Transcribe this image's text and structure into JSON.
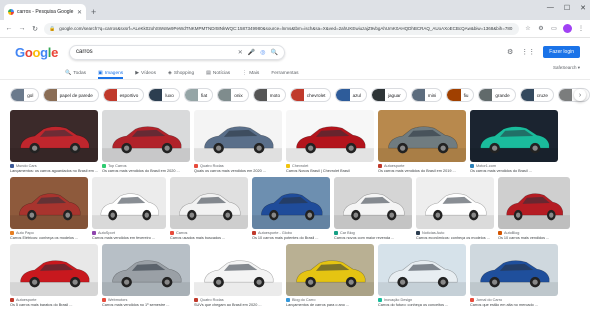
{
  "browser": {
    "tab_title": "carros - Pesquisa Google",
    "url": "google.com/search?q=carros&sxsrf=ALeKk02ohSWs8w9PeWdTNKMPMTNDrt8NkWQC:1587349980&source=lnms&tbm=isch&sa=X&ved=2ahUKEwiuzajZ9vbgAhUmK0AHQDhBCRAQ_AUoAXoECBcQAw&biw=1368&bih=780"
  },
  "search": {
    "query": "carros"
  },
  "header": {
    "signin_label": "Fazer login"
  },
  "tabs": [
    {
      "label": "Todas",
      "icon": "search-icon",
      "active": false
    },
    {
      "label": "Imagens",
      "icon": "image-icon",
      "active": true
    },
    {
      "label": "Vídeos",
      "icon": "video-icon",
      "active": false
    },
    {
      "label": "Shopping",
      "icon": "tag-icon",
      "active": false
    },
    {
      "label": "Notícias",
      "icon": "news-icon",
      "active": false
    },
    {
      "label": "Mais",
      "icon": "more-icon",
      "active": false
    },
    {
      "label": "Ferramentas",
      "icon": "",
      "active": false
    }
  ],
  "safesearch": "SafeSearch ▾",
  "chips": [
    {
      "label": "gol",
      "color": "#6b7a8c"
    },
    {
      "label": "papel de parede",
      "color": "#8a6d55"
    },
    {
      "label": "esportivo",
      "color": "#c0392b"
    },
    {
      "label": "luxo",
      "color": "#2c3e50"
    },
    {
      "label": "fiat",
      "color": "#95a5a6"
    },
    {
      "label": "onix",
      "color": "#7f8c8d"
    },
    {
      "label": "moto",
      "color": "#555555"
    },
    {
      "label": "chevrolet",
      "color": "#c0392b"
    },
    {
      "label": "azul",
      "color": "#2e5c9a"
    },
    {
      "label": "jaguar",
      "color": "#2d3436"
    },
    {
      "label": "mini",
      "color": "#5d6d7e"
    },
    {
      "label": "fiu",
      "color": "#a04000"
    },
    {
      "label": "grande",
      "color": "#616a6b"
    },
    {
      "label": "cruze",
      "color": "#34495e"
    },
    {
      "label": "hrev",
      "color": "#7b7d7d"
    }
  ],
  "results": [
    [
      {
        "source": "Mundo Cars",
        "caption": "Lançamentos: os carros aguardados no Brasil em ...",
        "bg": "#3b2a2a",
        "car": "#c0262d",
        "fav": "#3b5998"
      },
      {
        "source": "Top Carros",
        "caption": "Os carros mais vendidos do Brasil em 2020 ...",
        "bg": "#d9dadb",
        "car": "#b1222a",
        "fav": "#2ecc71"
      },
      {
        "source": "Quatro Rodas",
        "caption": "Quais os carros mais vendidos em 2020 ...",
        "bg": "#f4f4f4",
        "car": "#5a6f8a",
        "fav": "#e74c3c"
      },
      {
        "source": "Chevrolet",
        "caption": "Carros Novos Brasil | Chevrolet Brasil",
        "bg": "#f7f7f7",
        "car": "#b3141c",
        "fav": "#f1c40f"
      },
      {
        "source": "Autoesporte",
        "caption": "Os carros mais vendidos do Brasil em 2019 ...",
        "bg": "#b8894d",
        "car": "#707c80",
        "fav": "#c0392b"
      },
      {
        "source": "Motor1.com",
        "caption": "Os carros mais vendidos do Brasil ...",
        "bg": "#1b2430",
        "car": "#1abc9c",
        "fav": "#2980b9"
      }
    ],
    [
      {
        "source": "Auto Papo",
        "caption": "Carros Elétricos: conheça os modelos ...",
        "bg": "#8e5a3c",
        "car": "#a8342e",
        "fav": "#e67e22"
      },
      {
        "source": "AutoSport",
        "caption": "Carros mais vendidos em fevereiro ...",
        "bg": "#ececec",
        "car": "#ffffff",
        "fav": "#8e44ad"
      },
      {
        "source": "Carros",
        "caption": "Carros usados mais buscados ...",
        "bg": "#e0e0e0",
        "car": "#f2f2f2",
        "fav": "#e74c3c"
      },
      {
        "source": "Autoesporte - Globo",
        "caption": "Os 10 carros mais potentes do Brasil ...",
        "bg": "#6d8fb0",
        "car": "#1f4c9a",
        "fav": "#c0392b"
      },
      {
        "source": "Car Blog",
        "caption": "Carros novos com maior revenda ...",
        "bg": "#d5d5d5",
        "car": "#f5f5f5",
        "fav": "#16a085"
      },
      {
        "source": "Notícias Auto",
        "caption": "Carros econômicos: conheça os modelos ...",
        "bg": "#eeeeee",
        "car": "#ffffff",
        "fav": "#2c3e50"
      },
      {
        "source": "AutoBlog",
        "caption": "Os 10 carros mais vendidos ...",
        "bg": "#cfcfcf",
        "car": "#b51c23",
        "fav": "#d35400"
      }
    ],
    [
      {
        "source": "Autoesporte",
        "caption": "Os 5 carros mais baratos do Brasil ...",
        "bg": "#e8e8e8",
        "car": "#c8181e",
        "fav": "#c0392b"
      },
      {
        "source": "Webmotors",
        "caption": "Carros mais vendidos no 1º semestre ...",
        "bg": "#b7bfc6",
        "car": "#9aa0a6",
        "fav": "#e74c3c"
      },
      {
        "source": "Quatro Rodas",
        "caption": "SUVs que chegam ao Brasil em 2020 ...",
        "bg": "#ffffff",
        "car": "#f4f4f4",
        "fav": "#c0392b"
      },
      {
        "source": "Blog do Carro",
        "caption": "Lançamentos de carros para o ano ...",
        "bg": "#b9b093",
        "car": "#e5c412",
        "fav": "#3498db"
      },
      {
        "source": "Inovação Design",
        "caption": "Carros do futuro: conheça os conceitos ...",
        "bg": "#d6e2ea",
        "car": "#e8eef2",
        "fav": "#1abc9c"
      },
      {
        "source": "Jornal do Carro",
        "caption": "Carros que estão em alta no mercado ...",
        "bg": "#cfd8de",
        "car": "#1f4f9c",
        "fav": "#e74c3c"
      }
    ]
  ]
}
